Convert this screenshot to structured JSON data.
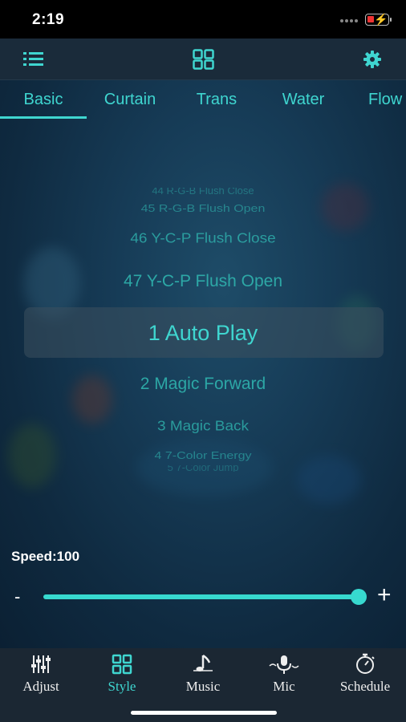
{
  "status_bar": {
    "time": "2:19",
    "battery_icon": "battery-charging-low-icon"
  },
  "top_nav": {
    "left_icon": "list-menu-icon",
    "center_icon": "grid-icon",
    "right_icon": "gear-icon"
  },
  "tabs": [
    {
      "label": "Basic",
      "active": true
    },
    {
      "label": "Curtain",
      "active": false
    },
    {
      "label": "Trans",
      "active": false
    },
    {
      "label": "Water",
      "active": false
    },
    {
      "label": "Flow",
      "active": false
    }
  ],
  "picker": {
    "items": [
      "44 R-G-B Flush Close",
      "45 R-G-B Flush Open",
      "46 Y-C-P Flush Close",
      "47 Y-C-P Flush Open",
      "1 Auto Play",
      "2 Magic Forward",
      "3 Magic Back",
      "4 7-Color Energy",
      "5 7-Color Jump"
    ],
    "selected": "1 Auto Play"
  },
  "speed": {
    "label": "Speed:100",
    "value": 100,
    "max": 100,
    "minus": "-",
    "plus": "+"
  },
  "bottom_nav": [
    {
      "label": "Adjust",
      "icon": "sliders-icon",
      "active": false
    },
    {
      "label": "Style",
      "icon": "grid-icon",
      "active": true
    },
    {
      "label": "Music",
      "icon": "music-note-icon",
      "active": false
    },
    {
      "label": "Mic",
      "icon": "microphone-icon",
      "active": false
    },
    {
      "label": "Schedule",
      "icon": "stopwatch-icon",
      "active": false
    }
  ],
  "colors": {
    "accent": "#3fd6d0",
    "list_text": "#2fb3ae",
    "nav_bg": "#1a2b3a",
    "bottom_bg": "#1b2733"
  }
}
